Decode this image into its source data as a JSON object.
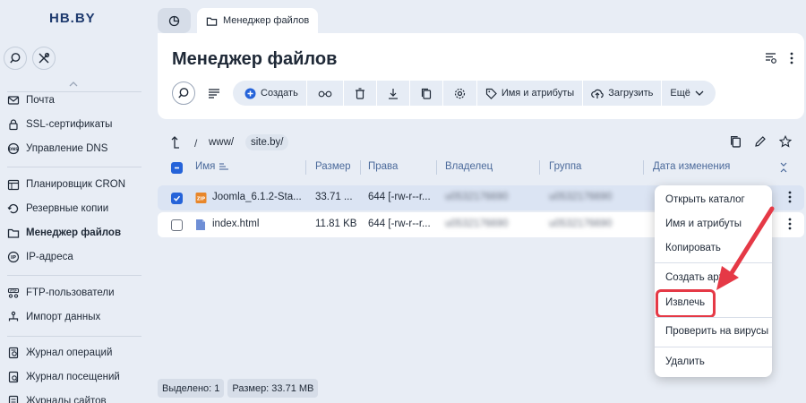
{
  "app": {
    "logo": "HB.BY"
  },
  "sidebar": {
    "items": [
      {
        "label": "Почта",
        "icon": "envelope-icon"
      },
      {
        "label": "SSL-сертификаты",
        "icon": "lock-icon"
      },
      {
        "label": "Управление DNS",
        "icon": "dns-icon"
      },
      {
        "label": "Планировщик CRON",
        "icon": "calendar-icon"
      },
      {
        "label": "Резервные копии",
        "icon": "backup-icon"
      },
      {
        "label": "Менеджер файлов",
        "icon": "folder-icon",
        "active": true
      },
      {
        "label": "IP-адреса",
        "icon": "ip-icon"
      },
      {
        "label": "FTP-пользователи",
        "icon": "ftp-icon"
      },
      {
        "label": "Импорт данных",
        "icon": "import-icon"
      },
      {
        "label": "Журнал операций",
        "icon": "journal-icon"
      },
      {
        "label": "Журнал посещений",
        "icon": "visits-icon"
      },
      {
        "label": "Журналы сайтов",
        "icon": "site-logs-icon"
      }
    ]
  },
  "tabs": {
    "active_label": "Менеджер файлов"
  },
  "header": {
    "title": "Менеджер файлов",
    "toolbar": {
      "create": "Создать",
      "name_attrs": "Имя и атрибуты",
      "upload": "Загрузить",
      "more": "Ещё"
    }
  },
  "path": {
    "separator": "/",
    "crumbs": [
      "www/",
      "site.by/"
    ]
  },
  "table": {
    "columns": [
      "Имя",
      "Размер",
      "Права",
      "Владелец",
      "Группа",
      "Дата изменения"
    ],
    "rows": [
      {
        "name": "Joomla_6.1.2-Sta...",
        "size": "33.71 ...",
        "perms": "644 [-rw-r--r...",
        "owner": "u0532176690",
        "group": "u0532176690",
        "selected": true,
        "file_icon": "zip-archive-icon"
      },
      {
        "name": "index.html",
        "size": "11.81 KB",
        "perms": "644 [-rw-r--r...",
        "owner": "u0532176690",
        "group": "u0532176690",
        "selected": false,
        "file_icon": "document-icon"
      }
    ]
  },
  "context_menu": {
    "items": [
      "Открыть каталог",
      "Имя и атрибуты",
      "Копировать",
      "Создать арх",
      "Извлечь",
      "Проверить на вирусы",
      "Удалить"
    ]
  },
  "status": {
    "selected": "Выделено: 1",
    "size": "Размер: 33.71 MB"
  },
  "colors": {
    "accent": "#2563d9",
    "highlight": "#e53946",
    "selected_row": "#dbe4f3"
  }
}
